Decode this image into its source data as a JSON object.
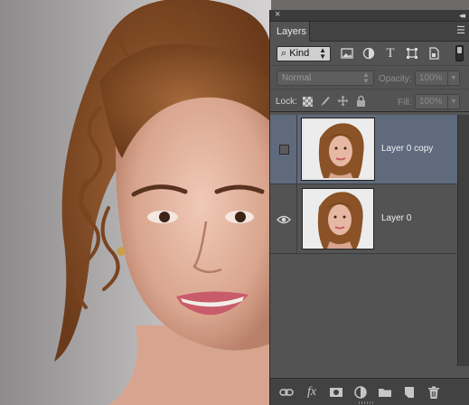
{
  "canvas": {
    "subject": "portrait photo of a woman with curly auburn hair"
  },
  "panel": {
    "close_glyph": "×",
    "collapse_glyph": "◂◂",
    "tab_label": "Layers",
    "menu_glyph": "☰",
    "filter": {
      "kind_label": "Kind",
      "kind_prefix_glyph": "⌕",
      "icons": [
        "image-filter-icon",
        "adjustment-filter-icon",
        "type-filter-icon",
        "shape-filter-icon",
        "smart-object-filter-icon"
      ]
    },
    "blend": {
      "mode": "Normal",
      "opacity_label": "Opacity:",
      "opacity_value": "100%"
    },
    "lock": {
      "label": "Lock:",
      "fill_label": "Fill:",
      "fill_value": "100%"
    },
    "layers": [
      {
        "name": "Layer 0 copy",
        "visible": false,
        "selected": true
      },
      {
        "name": "Layer 0",
        "visible": true,
        "selected": false
      }
    ],
    "bottom_icons": [
      "link-layers-icon",
      "fx-icon",
      "add-mask-icon",
      "adjustment-layer-icon",
      "new-group-icon",
      "new-layer-icon",
      "delete-layer-icon"
    ],
    "fx_label": "fx"
  },
  "colors": {
    "panel_bg": "#535353",
    "selected_row": "#5f6a7d",
    "hair": "#8a5226"
  }
}
